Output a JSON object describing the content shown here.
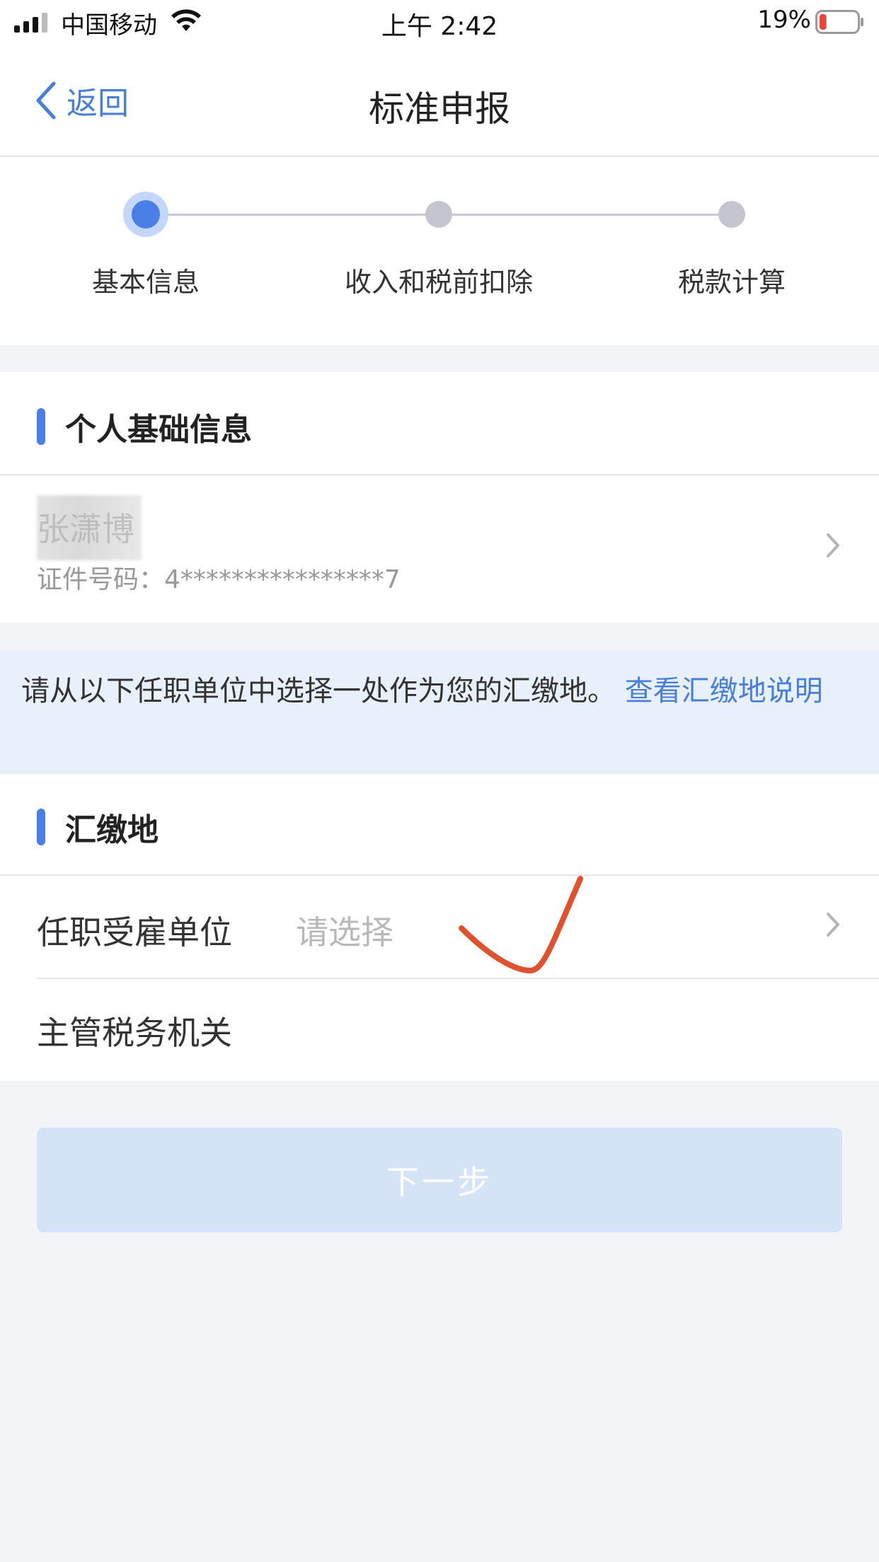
{
  "status_bar": {
    "carrier": "中国移动",
    "time": "上午 2:42",
    "battery_percent": "19%",
    "battery_level": 0.19,
    "battery_color": "#e8453c"
  },
  "nav": {
    "back_label": "返回",
    "title": "标准申报"
  },
  "steps": [
    {
      "label": "基本信息",
      "active": true
    },
    {
      "label": "收入和税前扣除",
      "active": false
    },
    {
      "label": "税款计算",
      "active": false
    }
  ],
  "personal_section": {
    "title": "个人基础信息",
    "name": "张潇博",
    "id_label": "证件号码：",
    "id_value": "4****************7"
  },
  "notice": {
    "text": "请从以下任职单位中选择一处作为您的汇缴地。",
    "link": "查看汇缴地说明"
  },
  "payment_section": {
    "title": "汇缴地",
    "employer_label": "任职受雇单位",
    "employer_placeholder": "请选择",
    "tax_office_label": "主管税务机关"
  },
  "next_button": "下一步",
  "colors": {
    "accent": "#4a7fe8",
    "link": "#4a7fd8",
    "annotation_mark": "#e0522f"
  }
}
